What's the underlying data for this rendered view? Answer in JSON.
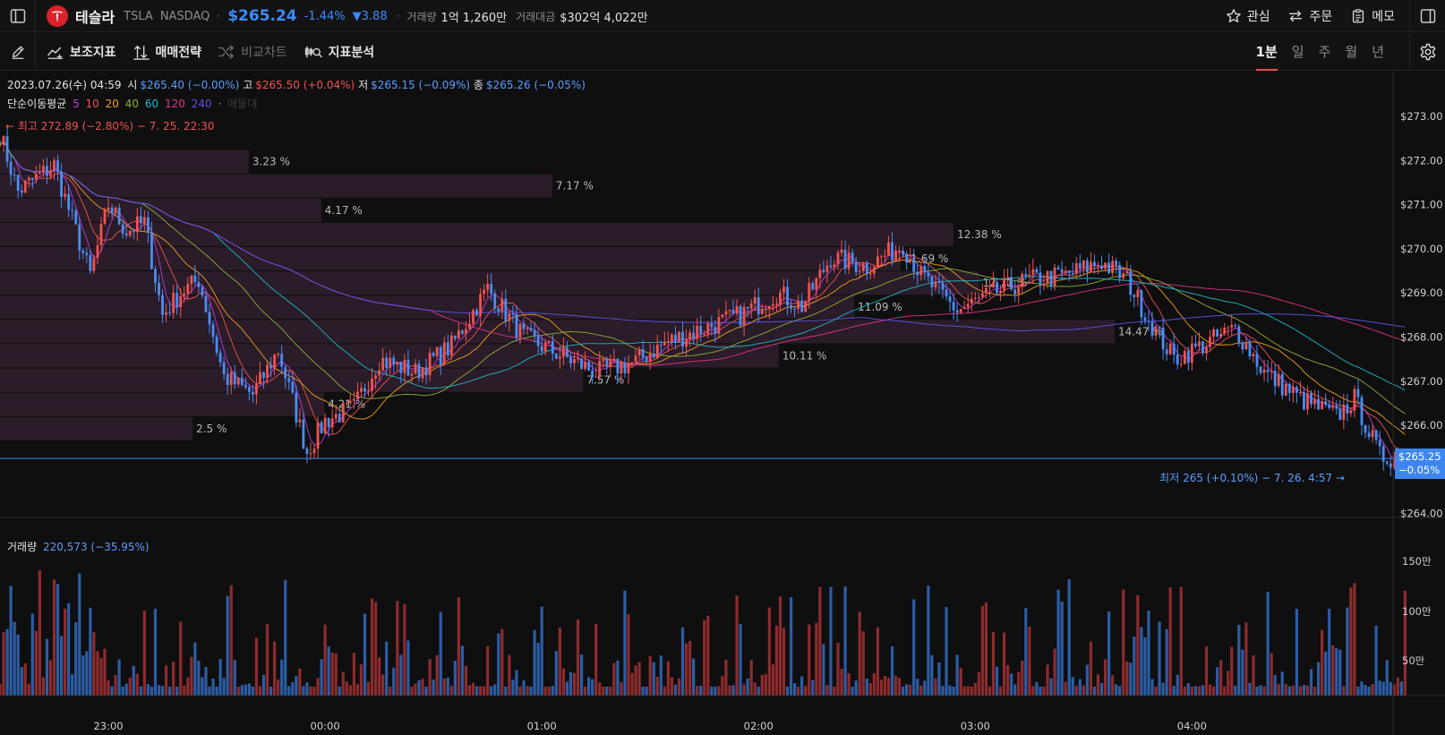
{
  "header": {
    "stock_name": "테슬라",
    "ticker": "TSLA",
    "exchange": "NASDAQ",
    "price": "$265.24",
    "change_pct": "-1.44%",
    "change_abs": "▼3.88",
    "volume_label": "거래량",
    "volume_value": "1억 1,260만",
    "turnover_label": "거래대금",
    "turnover_value": "$302억 4,022만",
    "actions": [
      {
        "label": "관심",
        "icon": "star-icon"
      },
      {
        "label": "주문",
        "icon": "swap-arrows-icon"
      },
      {
        "label": "메모",
        "icon": "clipboard-icon"
      }
    ]
  },
  "toolbar": {
    "tools": [
      {
        "label": "보조지표",
        "icon": "indicator-line-icon",
        "disabled": false
      },
      {
        "label": "매매전략",
        "icon": "sort-arrows-icon",
        "disabled": false
      },
      {
        "label": "비교차트",
        "icon": "shuffle-icon",
        "disabled": true
      },
      {
        "label": "지표분석",
        "icon": "candles-search-icon",
        "disabled": false
      }
    ],
    "periods": [
      {
        "label": "1분",
        "active": true
      },
      {
        "label": "일",
        "active": false
      },
      {
        "label": "주",
        "active": false
      },
      {
        "label": "월",
        "active": false
      },
      {
        "label": "년",
        "active": false
      }
    ]
  },
  "legend": {
    "datetime": "2023.07.26(수) 04:59",
    "open_label": "시",
    "open_value": "$265.40 (−0.00%)",
    "high_label": "고",
    "high_value": "$265.50 (+0.04%)",
    "low_label": "저",
    "low_value": "$265.15 (−0.09%)",
    "close_label": "종",
    "close_value": "$265.26 (−0.05%)",
    "ma_label": "단순이동평균",
    "ma_periods": [
      {
        "label": "5",
        "color": "#c23bd6"
      },
      {
        "label": "10",
        "color": "#ef5350"
      },
      {
        "label": "20",
        "color": "#f0a020"
      },
      {
        "label": "40",
        "color": "#8fb03a"
      },
      {
        "label": "60",
        "color": "#20b8c8"
      },
      {
        "label": "120",
        "color": "#e0338c"
      },
      {
        "label": "240",
        "color": "#5a55e6"
      }
    ],
    "ma_extra": "매물대",
    "max_annotation": "← 최고 272.89 (−2.80%) − 7. 25. 22:30",
    "min_annotation": "최저 265 (+0.10%) − 7. 26. 4:57 →",
    "last_price": "$265.25",
    "last_change": "−0.05%",
    "volume_label": "거래량",
    "volume_value": "220,573 (−35.95%)"
  },
  "chart_data": {
    "type": "candlestick",
    "y_axis": {
      "ticks": [
        "$273.00",
        "$272.00",
        "$271.00",
        "$270.00",
        "$269.00",
        "$268.00",
        "$267.00",
        "$266.00",
        "$264.00"
      ],
      "range": [
        263.8,
        273.9
      ]
    },
    "x_axis": {
      "ticks": [
        "23:00",
        "00:00",
        "01:00",
        "02:00",
        "03:00",
        "04:00"
      ]
    },
    "volume_axis": {
      "ticks": [
        "150만",
        "100만",
        "50만"
      ]
    },
    "price_keypoints": [
      {
        "t": "22:30",
        "price": 272.6
      },
      {
        "t": "22:35",
        "price": 271.3
      },
      {
        "t": "22:45",
        "price": 271.9
      },
      {
        "t": "22:55",
        "price": 269.4
      },
      {
        "t": "23:00",
        "price": 271.0
      },
      {
        "t": "23:05",
        "price": 270.4
      },
      {
        "t": "23:10",
        "price": 270.6
      },
      {
        "t": "23:15",
        "price": 268.5
      },
      {
        "t": "23:20",
        "price": 269.0
      },
      {
        "t": "23:25",
        "price": 269.3
      },
      {
        "t": "23:32",
        "price": 267.1
      },
      {
        "t": "23:40",
        "price": 266.7
      },
      {
        "t": "23:47",
        "price": 267.7
      },
      {
        "t": "23:55",
        "price": 265.4
      },
      {
        "t": "00:00",
        "price": 266.1
      },
      {
        "t": "00:08",
        "price": 266.4
      },
      {
        "t": "00:15",
        "price": 267.5
      },
      {
        "t": "00:25",
        "price": 267.2
      },
      {
        "t": "00:35",
        "price": 267.8
      },
      {
        "t": "00:45",
        "price": 269.1
      },
      {
        "t": "00:55",
        "price": 268.0
      },
      {
        "t": "01:05",
        "price": 267.6
      },
      {
        "t": "01:15",
        "price": 267.2
      },
      {
        "t": "01:25",
        "price": 267.4
      },
      {
        "t": "01:35",
        "price": 267.9
      },
      {
        "t": "01:45",
        "price": 268.2
      },
      {
        "t": "01:55",
        "price": 268.5
      },
      {
        "t": "02:05",
        "price": 269.0
      },
      {
        "t": "02:12",
        "price": 268.7
      },
      {
        "t": "02:20",
        "price": 269.8
      },
      {
        "t": "02:30",
        "price": 269.6
      },
      {
        "t": "02:40",
        "price": 270.1
      },
      {
        "t": "02:45",
        "price": 269.4
      },
      {
        "t": "02:55",
        "price": 268.6
      },
      {
        "t": "03:05",
        "price": 269.0
      },
      {
        "t": "03:15",
        "price": 269.3
      },
      {
        "t": "03:25",
        "price": 269.4
      },
      {
        "t": "03:35",
        "price": 269.7
      },
      {
        "t": "03:42",
        "price": 269.3
      },
      {
        "t": "03:48",
        "price": 268.4
      },
      {
        "t": "03:55",
        "price": 267.5
      },
      {
        "t": "04:05",
        "price": 267.9
      },
      {
        "t": "04:12",
        "price": 268.2
      },
      {
        "t": "04:20",
        "price": 267.2
      },
      {
        "t": "04:30",
        "price": 266.6
      },
      {
        "t": "04:40",
        "price": 266.2
      },
      {
        "t": "04:45",
        "price": 266.6
      },
      {
        "t": "04:52",
        "price": 265.3
      },
      {
        "t": "04:59",
        "price": 265.25
      }
    ],
    "volume_profile": [
      {
        "price_low": 271.7,
        "price_high": 272.25,
        "pct": "3.23 %"
      },
      {
        "price_low": 271.15,
        "price_high": 271.7,
        "pct": "7.17 %"
      },
      {
        "price_low": 270.6,
        "price_high": 271.15,
        "pct": "4.17 %"
      },
      {
        "price_low": 270.05,
        "price_high": 270.6,
        "pct": "12.38 %"
      },
      {
        "price_low": 269.5,
        "price_high": 270.05,
        "pct": "11.69 %"
      },
      {
        "price_low": 268.95,
        "price_high": 269.5,
        "pct": "12.71 %"
      },
      {
        "price_low": 268.4,
        "price_high": 268.95,
        "pct": "11.09 %"
      },
      {
        "price_low": 267.85,
        "price_high": 268.4,
        "pct": "14.47 %"
      },
      {
        "price_low": 267.3,
        "price_high": 267.85,
        "pct": "10.11 %"
      },
      {
        "price_low": 266.75,
        "price_high": 267.3,
        "pct": "7.57 %"
      },
      {
        "price_low": 266.2,
        "price_high": 266.75,
        "pct": "4.21 %"
      },
      {
        "price_low": 265.65,
        "price_high": 266.2,
        "pct": "2.5 %"
      }
    ],
    "last_price": 265.25
  }
}
